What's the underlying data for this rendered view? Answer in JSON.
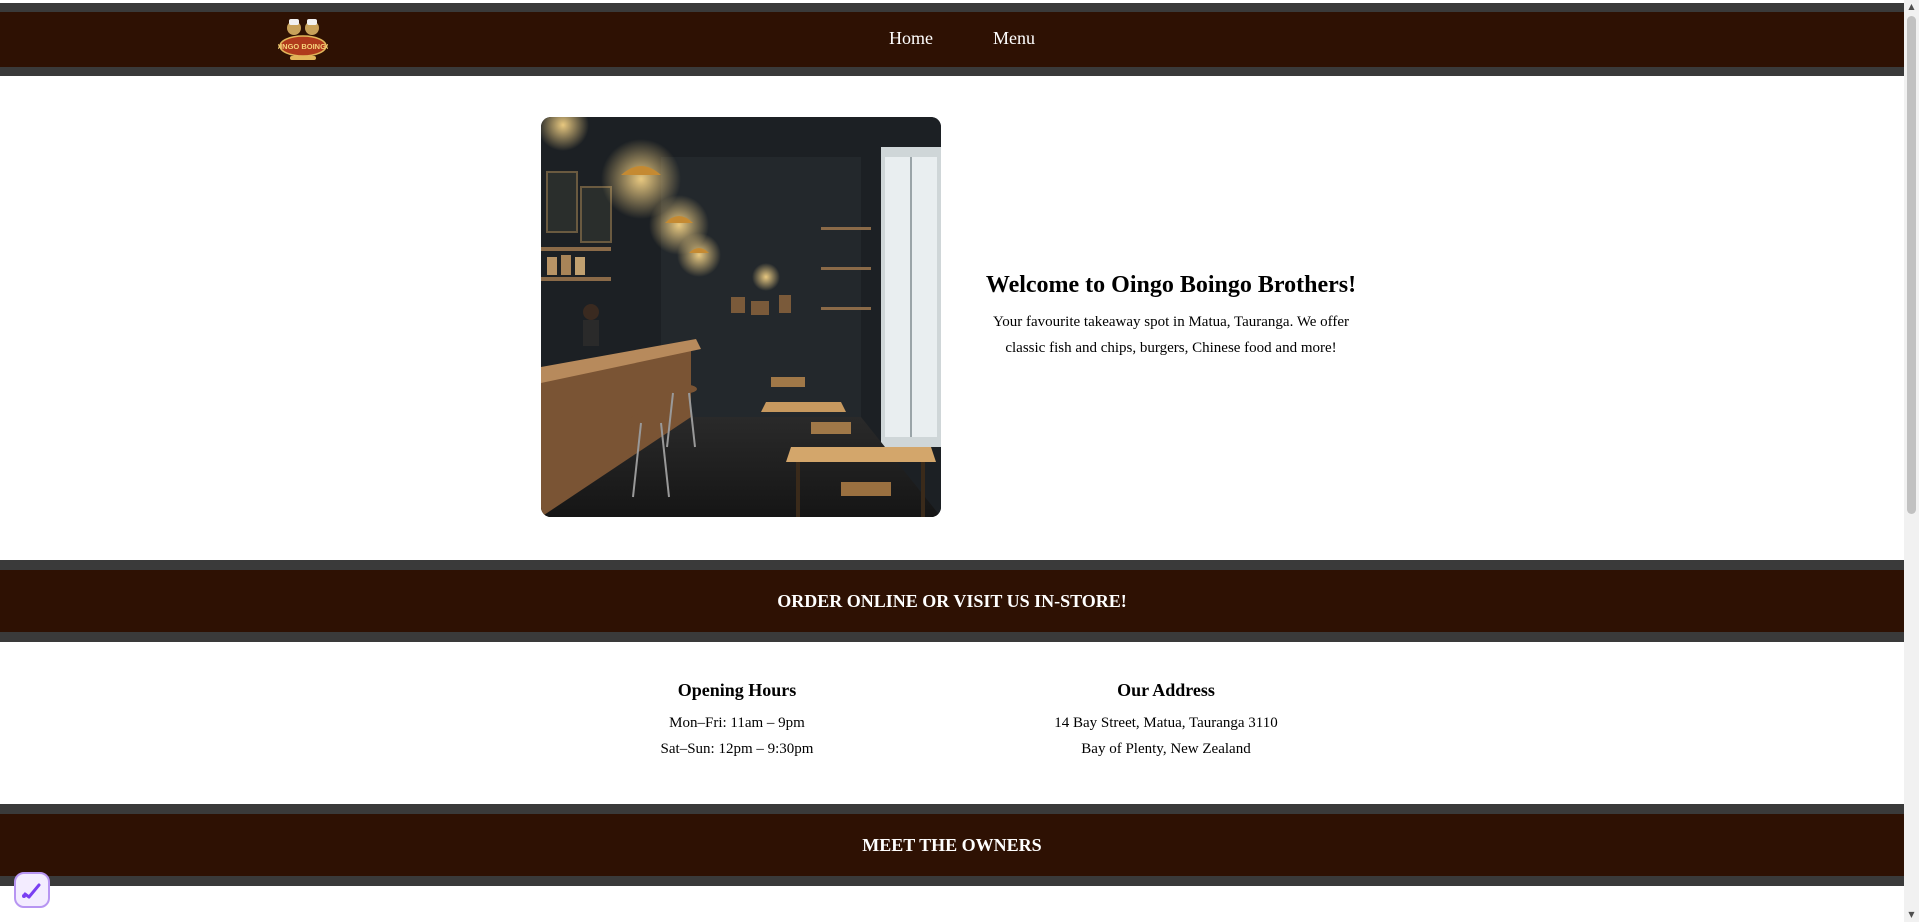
{
  "nav": {
    "logo_text": "OINGO BOINGO",
    "links": [
      {
        "label": "Home"
      },
      {
        "label": "Menu"
      }
    ]
  },
  "hero": {
    "title": "Welcome to Oingo Boingo Brothers!",
    "description": "Your favourite takeaway spot in Matua, Tauranga. We offer classic fish and chips, burgers, Chinese food and more!"
  },
  "banners": {
    "order": "ORDER ONLINE OR VISIT US IN-STORE!",
    "owners": "MEET THE OWNERS"
  },
  "opening_hours": {
    "title": "Opening Hours",
    "lines": [
      "Mon–Fri: 11am – 9pm",
      "Sat–Sun: 12pm – 9:30pm"
    ]
  },
  "address": {
    "title": "Our Address",
    "lines": [
      "14 Bay Street, Matua, Tauranga 3110",
      "Bay of Plenty, New Zealand"
    ]
  },
  "colors": {
    "brand_brown": "#2e1103",
    "border_grey": "#3a3a3a",
    "widget_accent": "#7a3ff2"
  }
}
